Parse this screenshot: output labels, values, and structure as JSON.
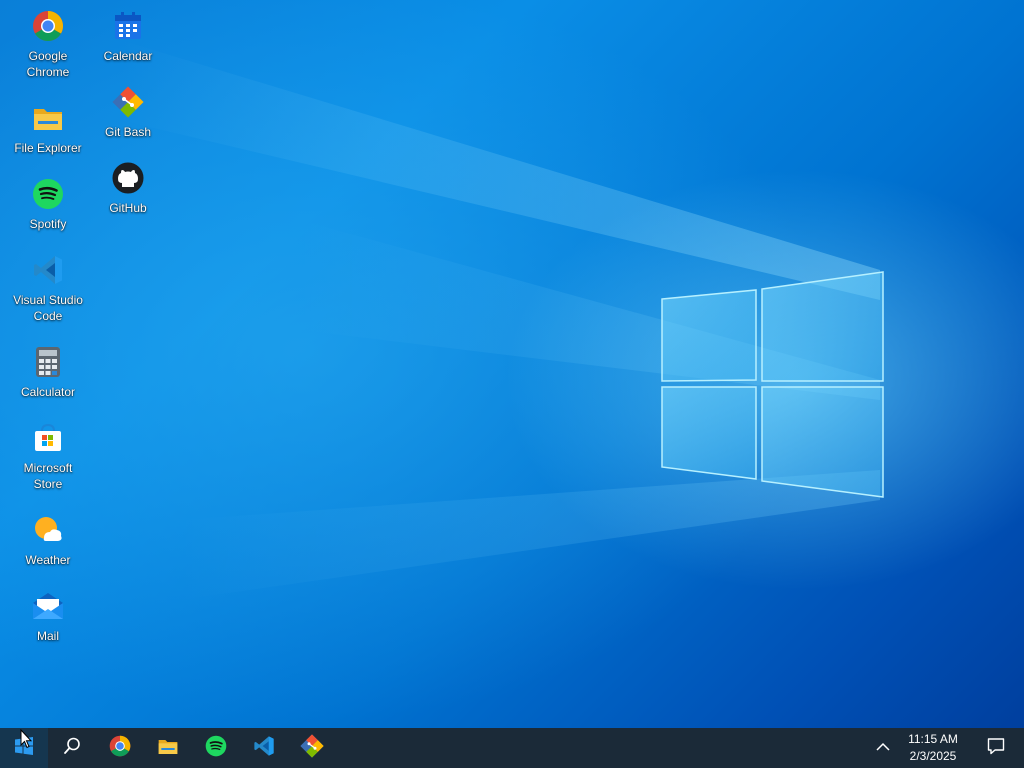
{
  "desktop": {
    "icons": [
      {
        "label": "Google Chrome",
        "icon": "chrome-icon"
      },
      {
        "label": "File Explorer",
        "icon": "folder-icon"
      },
      {
        "label": "Spotify",
        "icon": "spotify-icon"
      },
      {
        "label": "Visual Studio Code",
        "icon": "vscode-icon"
      },
      {
        "label": "Calculator",
        "icon": "calculator-icon"
      },
      {
        "label": "Microsoft Store",
        "icon": "store-icon"
      },
      {
        "label": "Weather",
        "icon": "weather-icon"
      },
      {
        "label": "Mail",
        "icon": "mail-icon"
      },
      {
        "label": "Calendar",
        "icon": "calendar-icon"
      },
      {
        "label": "Git Bash",
        "icon": "git-bash-icon"
      },
      {
        "label": "GitHub",
        "icon": "github-icon"
      }
    ]
  },
  "taskbar": {
    "pinned": [
      "chrome-icon",
      "folder-icon",
      "spotify-icon",
      "vscode-icon",
      "git-bash-icon"
    ],
    "clock": {
      "time": "11:15 AM",
      "date": "2/3/2025"
    }
  },
  "colors": {
    "taskbar": "#1b2a38",
    "wallpaper_main": "#0a8ee6",
    "wallpaper_dark": "#003f9e"
  }
}
